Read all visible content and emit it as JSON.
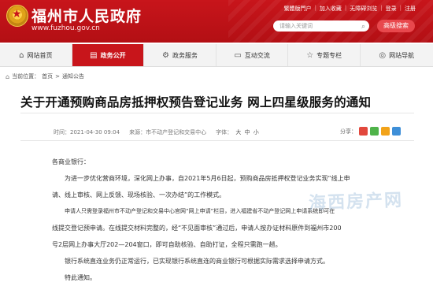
{
  "header": {
    "site_title": "福州市人民政府",
    "site_url": "www.fuzhou.gov.cn",
    "top_links": [
      "繁體版門户",
      "加入收藏",
      "无障碍浏览",
      "登录",
      "注册"
    ],
    "search_placeholder": "请输入关键词",
    "advanced_search": "高级搜索"
  },
  "nav": {
    "items": [
      {
        "label": "网站首页",
        "icon": "home-icon"
      },
      {
        "label": "政务公开",
        "icon": "document-icon"
      },
      {
        "label": "政务服务",
        "icon": "gear-icon"
      },
      {
        "label": "互动交流",
        "icon": "chat-icon"
      },
      {
        "label": "专题专栏",
        "icon": "star-icon"
      },
      {
        "label": "网站导航",
        "icon": "compass-icon"
      }
    ],
    "active_index": 1
  },
  "breadcrumb": {
    "prefix": "当前位置：",
    "items": [
      "首页",
      "通知公告"
    ],
    "separator": ">"
  },
  "article": {
    "title": "关于开通预购商品房抵押权预告登记业务 网上四星级服务的通知",
    "date": "时间：2021-04-30 09:04",
    "source": "来源：市不动产登记和交易中心",
    "font_size_label": "字体：",
    "font_sizes": [
      "大",
      "中",
      "小"
    ],
    "share_label": "分享：",
    "share_colors": [
      "#e2483d",
      "#4fb34a",
      "#f2a31a",
      "#3e8fd8"
    ],
    "paragraphs": [
      "各商业银行：",
      "为进一步优化营商环境，深化网上办事，自2021年5月6日起，预购商品房抵押权登记业务实现“线上申",
      "请、线上审核、网上反馈、现场核验、一次办结”的工作模式。",
      "申请人只需登录福州市不动产登记和交易中心官网“网上申请”栏目，进入福建省不动产登记网上申请系统即可在",
      "线提交登记预申请。在线提交材料完整的，经“不见面审核”通过后，申请人按办证材料原件到福州市200",
      "号2层网上办事大厅202—204窗口，即可自助核验、自助打证，全程只需跑一趟。",
      "银行系统直连业务仍正常运行，已实现银行系统直连的商业银行可根据实际需求选择申请方式。",
      "特此通知。"
    ],
    "watermark": "海西房产网"
  }
}
